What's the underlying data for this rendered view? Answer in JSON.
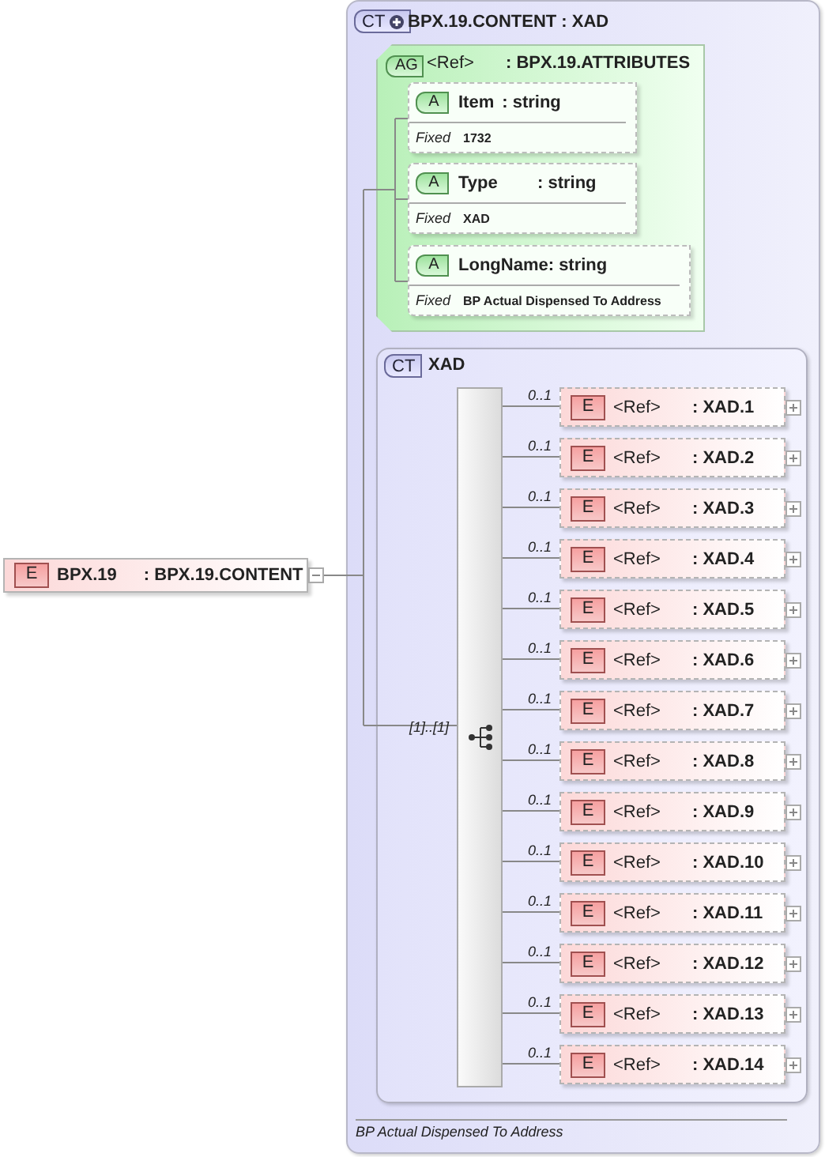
{
  "root": {
    "badge": "E",
    "name": "BPX.19",
    "type": ": BPX.19.CONTENT",
    "expanded": true
  },
  "complex_type": {
    "badge": "CT",
    "name": "BPX.19.CONTENT : XAD",
    "expanded": true,
    "documentation": "BP Actual Dispensed To Address",
    "attribute_group": {
      "badge": "AG",
      "ref": "<Ref>",
      "type": ": BPX.19.ATTRIBUTES",
      "attributes": [
        {
          "badge": "A",
          "name": "Item",
          "type": ": string",
          "fixed_label": "Fixed",
          "fixed_value": "1732"
        },
        {
          "badge": "A",
          "name": "Type",
          "type": ": string",
          "fixed_label": "Fixed",
          "fixed_value": "XAD"
        },
        {
          "badge": "A",
          "name": "LongName",
          "type": ": string",
          "fixed_label": "Fixed",
          "fixed_value": "BP Actual Dispensed To Address"
        }
      ]
    },
    "base_type": {
      "badge": "CT",
      "name": "XAD",
      "sequence": {
        "occurrence": "[1]..[1]",
        "elements": [
          {
            "occurrence": "0..1",
            "badge": "E",
            "ref": "<Ref>",
            "type": ": XAD.1",
            "expanded": false
          },
          {
            "occurrence": "0..1",
            "badge": "E",
            "ref": "<Ref>",
            "type": ": XAD.2",
            "expanded": false
          },
          {
            "occurrence": "0..1",
            "badge": "E",
            "ref": "<Ref>",
            "type": ": XAD.3",
            "expanded": false
          },
          {
            "occurrence": "0..1",
            "badge": "E",
            "ref": "<Ref>",
            "type": ": XAD.4",
            "expanded": false
          },
          {
            "occurrence": "0..1",
            "badge": "E",
            "ref": "<Ref>",
            "type": ": XAD.5",
            "expanded": false
          },
          {
            "occurrence": "0..1",
            "badge": "E",
            "ref": "<Ref>",
            "type": ": XAD.6",
            "expanded": false
          },
          {
            "occurrence": "0..1",
            "badge": "E",
            "ref": "<Ref>",
            "type": ": XAD.7",
            "expanded": false
          },
          {
            "occurrence": "0..1",
            "badge": "E",
            "ref": "<Ref>",
            "type": ": XAD.8",
            "expanded": false
          },
          {
            "occurrence": "0..1",
            "badge": "E",
            "ref": "<Ref>",
            "type": ": XAD.9",
            "expanded": false
          },
          {
            "occurrence": "0..1",
            "badge": "E",
            "ref": "<Ref>",
            "type": ": XAD.10",
            "expanded": false
          },
          {
            "occurrence": "0..1",
            "badge": "E",
            "ref": "<Ref>",
            "type": ": XAD.11",
            "expanded": false
          },
          {
            "occurrence": "0..1",
            "badge": "E",
            "ref": "<Ref>",
            "type": ": XAD.12",
            "expanded": false
          },
          {
            "occurrence": "0..1",
            "badge": "E",
            "ref": "<Ref>",
            "type": ": XAD.13",
            "expanded": false
          },
          {
            "occurrence": "0..1",
            "badge": "E",
            "ref": "<Ref>",
            "type": ": XAD.14",
            "expanded": false
          }
        ]
      }
    }
  }
}
